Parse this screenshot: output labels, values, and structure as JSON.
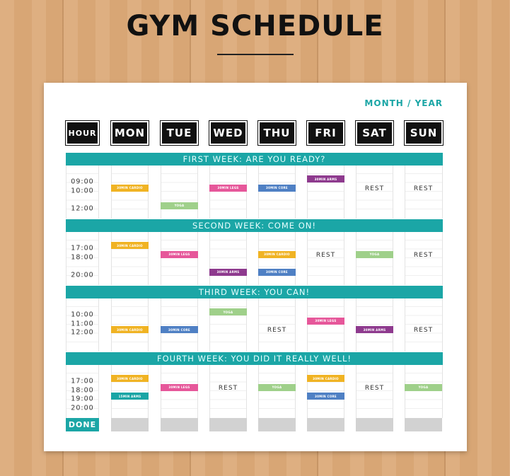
{
  "title": "GYM SCHEDULE",
  "month_year": "MONTH / YEAR",
  "headers": [
    "HOUR",
    "MON",
    "TUE",
    "WED",
    "THU",
    "FRI",
    "SAT",
    "SUN"
  ],
  "done_label": "DONE",
  "colors": {
    "accent": "#1ba6a6",
    "cardio": "#f0b323",
    "legs": "#e6579a",
    "core": "#4f80c4",
    "arms": "#8e3a8e",
    "yoga": "#9fd08a",
    "arms15": "#1aa5a5"
  },
  "weeks": [
    {
      "title": "FIRST WEEK: ARE YOU READY?",
      "hours": [
        {
          "time": "09:00",
          "slot": 0
        },
        {
          "time": "10:00",
          "slot": 1
        },
        {
          "time": "12:00",
          "slot": 3
        }
      ],
      "events": [
        {
          "day": "MON",
          "label": "30MIN CARDIO",
          "kind": "cardio",
          "slot": 1
        },
        {
          "day": "TUE",
          "label": "YOGA",
          "kind": "yoga",
          "slot": 3
        },
        {
          "day": "WED",
          "label": "30MIN LEGS",
          "kind": "legs",
          "slot": 1
        },
        {
          "day": "THU",
          "label": "30MIN CORE",
          "kind": "core",
          "slot": 1
        },
        {
          "day": "FRI",
          "label": "30MIN ARMS",
          "kind": "arms",
          "slot": 0
        },
        {
          "day": "SAT",
          "label": "REST",
          "kind": "rest",
          "slot": 1
        },
        {
          "day": "SUN",
          "label": "REST",
          "kind": "rest",
          "slot": 1
        }
      ]
    },
    {
      "title": "SECOND WEEK: COME ON!",
      "hours": [
        {
          "time": "17:00",
          "slot": 0
        },
        {
          "time": "18:00",
          "slot": 1
        },
        {
          "time": "20:00",
          "slot": 3
        }
      ],
      "events": [
        {
          "day": "MON",
          "label": "30MIN CARDIO",
          "kind": "cardio",
          "slot": 0
        },
        {
          "day": "TUE",
          "label": "30MIN LEGS",
          "kind": "legs",
          "slot": 1
        },
        {
          "day": "WED",
          "label": "30MIN ARMS",
          "kind": "arms",
          "slot": 3
        },
        {
          "day": "THU",
          "label": "30MIN CARDIO",
          "kind": "cardio",
          "slot": 1
        },
        {
          "day": "THU",
          "label": "30MIN CORE",
          "kind": "core",
          "slot": 3
        },
        {
          "day": "FRI",
          "label": "REST",
          "kind": "rest",
          "slot": 1
        },
        {
          "day": "SAT",
          "label": "YOGA",
          "kind": "yoga",
          "slot": 1
        },
        {
          "day": "SUN",
          "label": "REST",
          "kind": "rest",
          "slot": 1
        }
      ]
    },
    {
      "title": "THIRD WEEK: YOU CAN!",
      "hours": [
        {
          "time": "10:00",
          "slot": 0
        },
        {
          "time": "11:00",
          "slot": 1
        },
        {
          "time": "12:00",
          "slot": 2
        }
      ],
      "events": [
        {
          "day": "MON",
          "label": "30MIN CARDIO",
          "kind": "cardio",
          "slot": 2
        },
        {
          "day": "TUE",
          "label": "30MIN CORE",
          "kind": "core",
          "slot": 2
        },
        {
          "day": "WED",
          "label": "YOGA",
          "kind": "yoga",
          "slot": 0
        },
        {
          "day": "THU",
          "label": "REST",
          "kind": "rest",
          "slot": 2
        },
        {
          "day": "FRI",
          "label": "30MIN LEGS",
          "kind": "legs",
          "slot": 1
        },
        {
          "day": "SAT",
          "label": "30MIN ARMS",
          "kind": "arms",
          "slot": 2
        },
        {
          "day": "SUN",
          "label": "REST",
          "kind": "rest",
          "slot": 2
        }
      ]
    },
    {
      "title": "FOURTH WEEK: YOU DID IT REALLY WELL!",
      "hours": [
        {
          "time": "17:00",
          "slot": 0
        },
        {
          "time": "18:00",
          "slot": 1
        },
        {
          "time": "19:00",
          "slot": 2
        },
        {
          "time": "20:00",
          "slot": 3
        }
      ],
      "events": [
        {
          "day": "MON",
          "label": "30MIN CARDIO",
          "kind": "cardio",
          "slot": 0
        },
        {
          "day": "MON",
          "label": "15MIN ARMS",
          "kind": "arms15",
          "slot": 2
        },
        {
          "day": "TUE",
          "label": "30MIN LEGS",
          "kind": "legs",
          "slot": 1
        },
        {
          "day": "WED",
          "label": "REST",
          "kind": "rest",
          "slot": 1
        },
        {
          "day": "THU",
          "label": "YOGA",
          "kind": "yoga",
          "slot": 1
        },
        {
          "day": "FRI",
          "label": "30MIN CARDIO",
          "kind": "cardio",
          "slot": 0
        },
        {
          "day": "FRI",
          "label": "30MIN CORE",
          "kind": "core",
          "slot": 2
        },
        {
          "day": "SAT",
          "label": "REST",
          "kind": "rest",
          "slot": 1
        },
        {
          "day": "SUN",
          "label": "YOGA",
          "kind": "yoga",
          "slot": 1
        }
      ]
    }
  ]
}
